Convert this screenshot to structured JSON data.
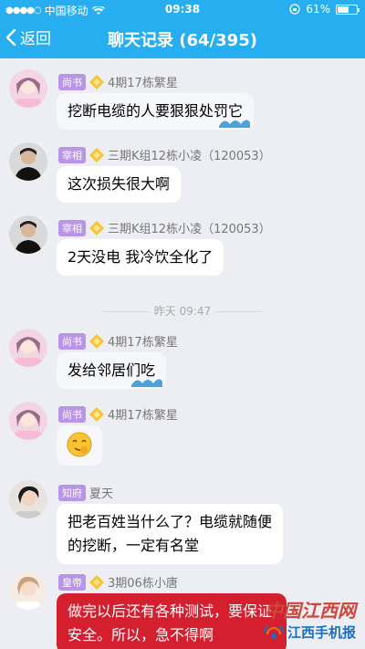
{
  "status_bar": {
    "carrier": "中国移动",
    "time": "09:38",
    "battery_text": "61%",
    "battery_level": 0.61
  },
  "nav": {
    "back_label": "返回",
    "title": "聊天记录 (64/395)"
  },
  "messages": [
    {
      "rank": "尚书",
      "name": "4期17栋繁星",
      "text": "挖断电缆的人要狠狠处罚它"
    },
    {
      "rank": "宰相",
      "name": "三期K组12栋小凌（120053）",
      "text": "这次损失很大啊"
    },
    {
      "rank": "宰相",
      "name": "三期K组12栋小凌（120053）",
      "text": "2天没电  我冷饮全化了"
    },
    {
      "rank": "尚书",
      "name": "4期17栋繁星",
      "text": "发给邻居们吃"
    },
    {
      "rank": "尚书",
      "name": "4期17栋繁星",
      "text": ""
    },
    {
      "rank": "知府",
      "name": "夏天",
      "text_line1": "把老百姓当什么了？电缆就随便",
      "text_line2": "的挖断，一定有名堂"
    },
    {
      "rank": "皇帝",
      "name": "3期06栋小唐",
      "text": "做完以后还有各种测试，要保证安全。所以，急不得啊"
    }
  ],
  "timestamp": "昨天 09:47",
  "watermark": {
    "top": "中国江西网",
    "bottom": "江西手机报"
  },
  "colors": {
    "header": "#26aef0",
    "rank_badge": "#b995e8",
    "highlight_bubble": "#d41f2e"
  }
}
